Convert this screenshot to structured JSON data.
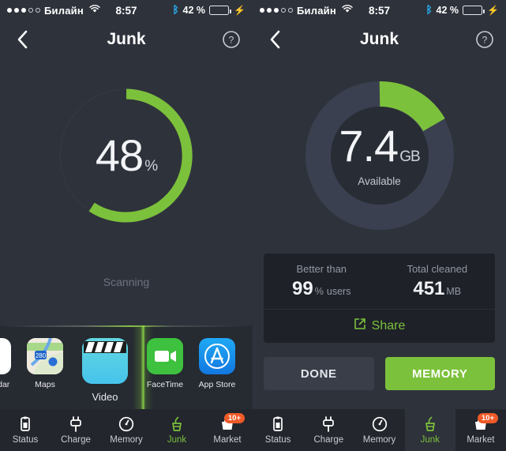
{
  "meta": {
    "accent_green": "#7cc13b",
    "bg_dark": "#2e323b",
    "panel_dark": "#23262d",
    "badge_orange": "#ef5a28"
  },
  "status_bar": {
    "carrier": "Билайн",
    "signal_dots_filled": 3,
    "signal_dots_total": 5,
    "wifi_icon": "wifi-icon",
    "time": "8:57",
    "bluetooth_icon": "bluetooth-icon",
    "battery_percent": "42 %",
    "battery_level": 42,
    "charging_icon": "lightning-bolt-icon"
  },
  "nav": {
    "back_icon": "chevron-left-icon",
    "title": "Junk",
    "help_icon": "question-mark-circle-icon"
  },
  "left_panel": {
    "gauge": {
      "value": "48",
      "unit": "%",
      "progress": 48,
      "arc_sweep_degrees": 232,
      "arc_start_degrees": -8,
      "ring_color": "#7cc13b",
      "track_color": "#343945"
    },
    "status_text": "Scanning",
    "scan_row": {
      "beam_icon": "scan-beam-icon",
      "apps": [
        {
          "name": "Calendar",
          "icon": "calendar-app-icon",
          "clipped": true
        },
        {
          "name": "Maps",
          "icon": "maps-app-icon",
          "clipped": false
        },
        {
          "name": "Video",
          "icon": "video-app-icon",
          "clipped": false,
          "highlighted": true
        },
        {
          "name": "FaceTime",
          "icon": "facetime-app-icon",
          "clipped": false
        },
        {
          "name": "App Store",
          "icon": "appstore-app-icon",
          "clipped": false
        }
      ]
    }
  },
  "right_panel": {
    "gauge": {
      "value": "7.4",
      "unit": "GB",
      "sub_label": "Available",
      "arc_sweep_degrees": 62,
      "arc_start_degrees": 0,
      "ring_color": "#7cc13b",
      "track_color": "#3b4050",
      "inner_color": "#282c34"
    },
    "stats": [
      {
        "label": "Better than",
        "value": "99",
        "unit": "%",
        "suffix": "users"
      },
      {
        "label": "Total cleaned",
        "value": "451",
        "unit": "MB",
        "suffix": ""
      }
    ],
    "share": {
      "icon": "external-link-icon",
      "label": "Share"
    },
    "buttons": {
      "done": "DONE",
      "memory": "MEMORY"
    }
  },
  "tabs": [
    {
      "label": "Status",
      "icon": "clipboard-battery-icon",
      "active": false,
      "badge": ""
    },
    {
      "label": "Charge",
      "icon": "power-plug-icon",
      "active": false,
      "badge": ""
    },
    {
      "label": "Memory",
      "icon": "gauge-meter-icon",
      "active": false,
      "badge": ""
    },
    {
      "label": "Junk",
      "icon": "broom-dustpan-icon",
      "active": true,
      "badge": ""
    },
    {
      "label": "Market",
      "icon": "shopping-bag-icon",
      "active": false,
      "badge": "10+"
    }
  ]
}
